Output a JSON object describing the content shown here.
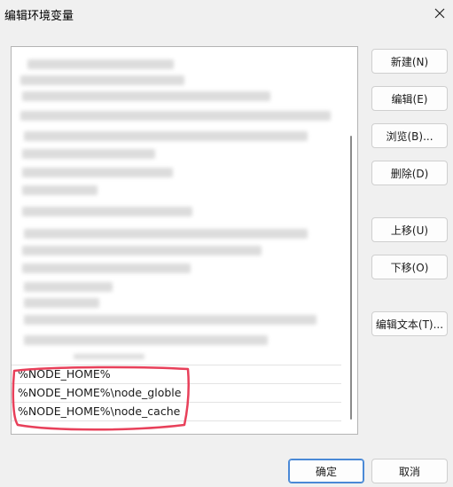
{
  "window": {
    "title": "编辑环境变量",
    "close_icon": "close-icon"
  },
  "list": {
    "visible_rows": [
      "%NODE_HOME%",
      "%NODE_HOME%\\node_globle",
      "%NODE_HOME%\\node_cache"
    ],
    "blurred_rows_note": "",
    "annotation_color": "#e8405a"
  },
  "buttons": {
    "new": "新建(N)",
    "edit": "编辑(E)",
    "browse": "浏览(B)...",
    "delete": "删除(D)",
    "move_up": "上移(U)",
    "move_down": "下移(O)",
    "edit_text": "编辑文本(T)...",
    "ok": "确定",
    "cancel": "取消"
  }
}
